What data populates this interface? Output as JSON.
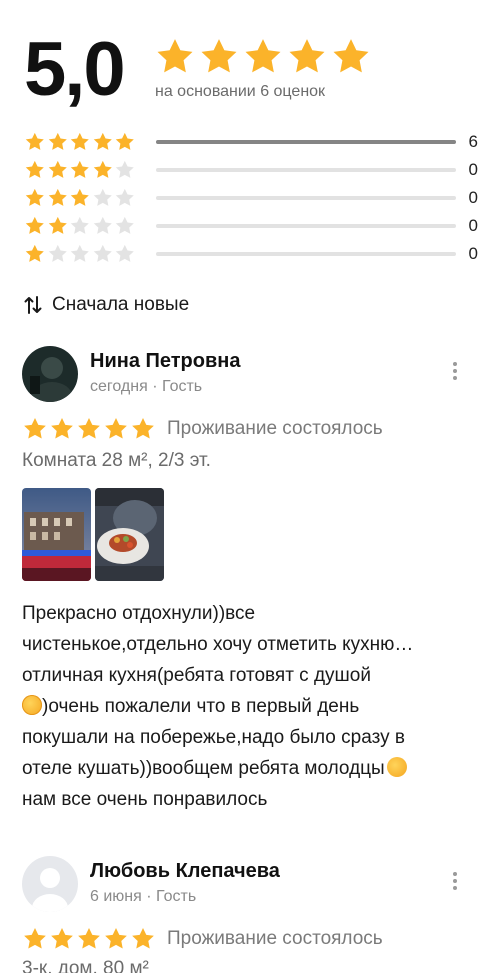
{
  "summary": {
    "average": "5,0",
    "stars_filled": 5,
    "based_on": "на основании 6 оценок"
  },
  "distribution": [
    {
      "stars": 5,
      "count": "6",
      "fraction": 1.0
    },
    {
      "stars": 4,
      "count": "0",
      "fraction": 0
    },
    {
      "stars": 3,
      "count": "0",
      "fraction": 0
    },
    {
      "stars": 2,
      "count": "0",
      "fraction": 0
    },
    {
      "stars": 1,
      "count": "0",
      "fraction": 0
    }
  ],
  "sort": {
    "label": "Сначала новые",
    "icon": "sort-arrows-icon"
  },
  "reviews": [
    {
      "author": "Нина Петровна",
      "meta": "сегодня · Гость",
      "rating": 5,
      "stay": "Проживание состоялось",
      "room": "Комната 28 м², 2/3 эт.",
      "photos": [
        "hotel-terrace-night-photo",
        "dessert-plate-photo"
      ],
      "text_line1": "Прекрасно отдохнули))все",
      "text_line2": "чистенькое,отдельно хочу отметить кухню…",
      "text_line3": "отличная кухня(ребята готовят с душой",
      "text_line4": ")очень пожалели что в первый день",
      "text_line5": "покушали на побережье,надо было сразу в",
      "text_line6": "отеле кушать))вообщем ребята молодцы",
      "text_line7": "нам все очень понравилось"
    },
    {
      "author": "Любовь Клепачева",
      "meta": "6 июня · Гость",
      "rating": 5,
      "stay": "Проживание состоялось",
      "room": "3-к. дом, 80 м²"
    }
  ],
  "colors": {
    "star_filled": "#FBB32A",
    "star_empty": "#E3E3E3",
    "bar_track": "#E2E2E2",
    "bar_fill": "#858585"
  }
}
